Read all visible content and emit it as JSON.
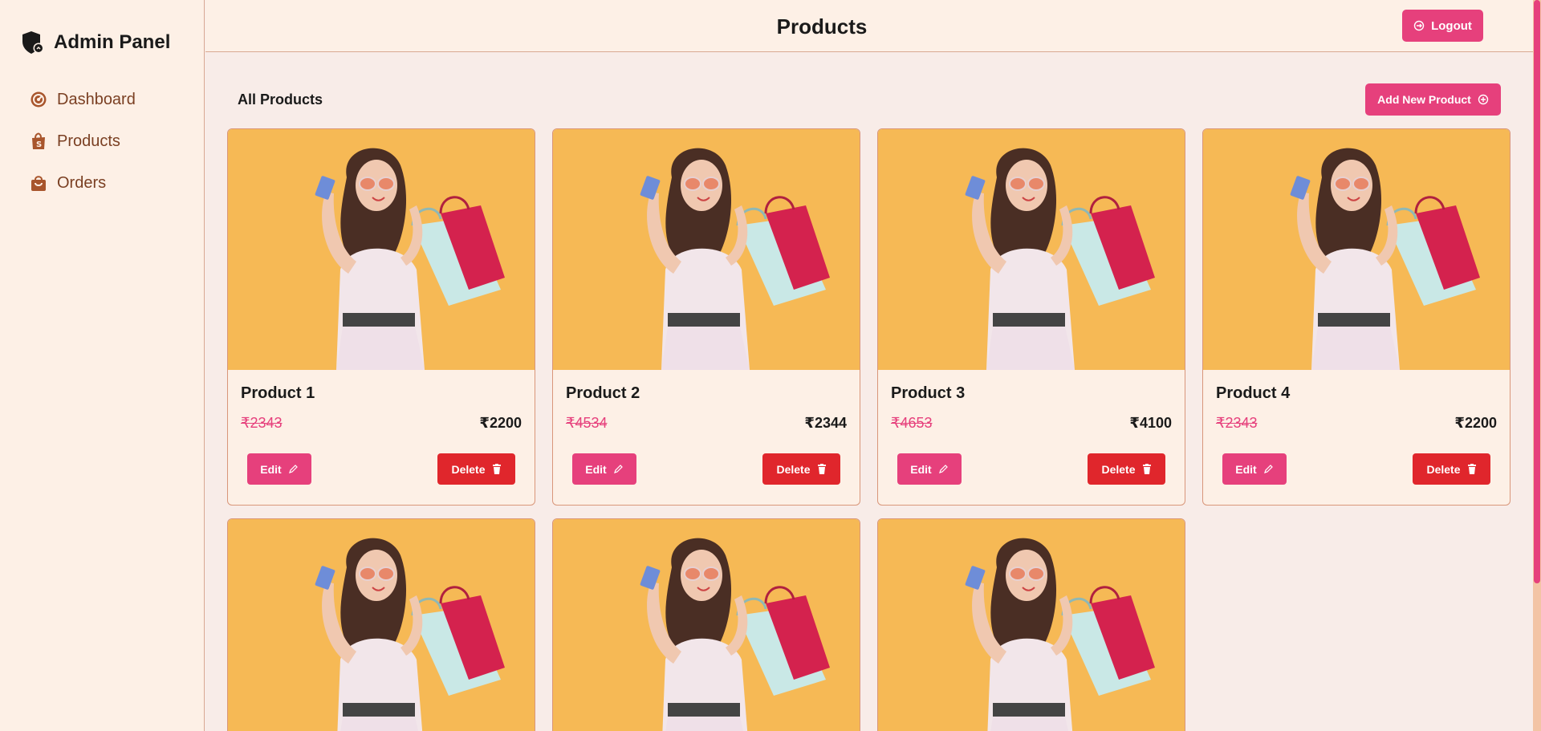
{
  "app": {
    "title": "Admin Panel",
    "icon": "shield-icon"
  },
  "sidebar": {
    "items": [
      {
        "label": "Dashboard",
        "icon": "gauge-icon"
      },
      {
        "label": "Products",
        "icon": "shopping-bag-icon"
      },
      {
        "label": "Orders",
        "icon": "bag-icon"
      }
    ]
  },
  "header": {
    "title": "Products",
    "logout_label": "Logout"
  },
  "main": {
    "section_title": "All Products",
    "add_label": "Add New Product"
  },
  "products": [
    {
      "name": "Product 1",
      "old_price": "₹2343",
      "price": "₹2200",
      "edit_label": "Edit",
      "delete_label": "Delete"
    },
    {
      "name": "Product 2",
      "old_price": "₹4534",
      "price": "₹2344",
      "edit_label": "Edit",
      "delete_label": "Delete"
    },
    {
      "name": "Product 3",
      "old_price": "₹4653",
      "price": "₹4100",
      "edit_label": "Edit",
      "delete_label": "Delete"
    },
    {
      "name": "Product 4",
      "old_price": "₹2343",
      "price": "₹2200",
      "edit_label": "Edit",
      "delete_label": "Delete"
    },
    {
      "name": "",
      "old_price": "",
      "price": "",
      "edit_label": "",
      "delete_label": ""
    },
    {
      "name": "",
      "old_price": "",
      "price": "",
      "edit_label": "",
      "delete_label": ""
    },
    {
      "name": "",
      "old_price": "",
      "price": "",
      "edit_label": "",
      "delete_label": ""
    }
  ],
  "colors": {
    "accent": "#e6407c",
    "danger": "#e0262c",
    "image_bg": "#f6b955",
    "sidebar_text": "#7a3f22",
    "background": "#f8ece8"
  }
}
